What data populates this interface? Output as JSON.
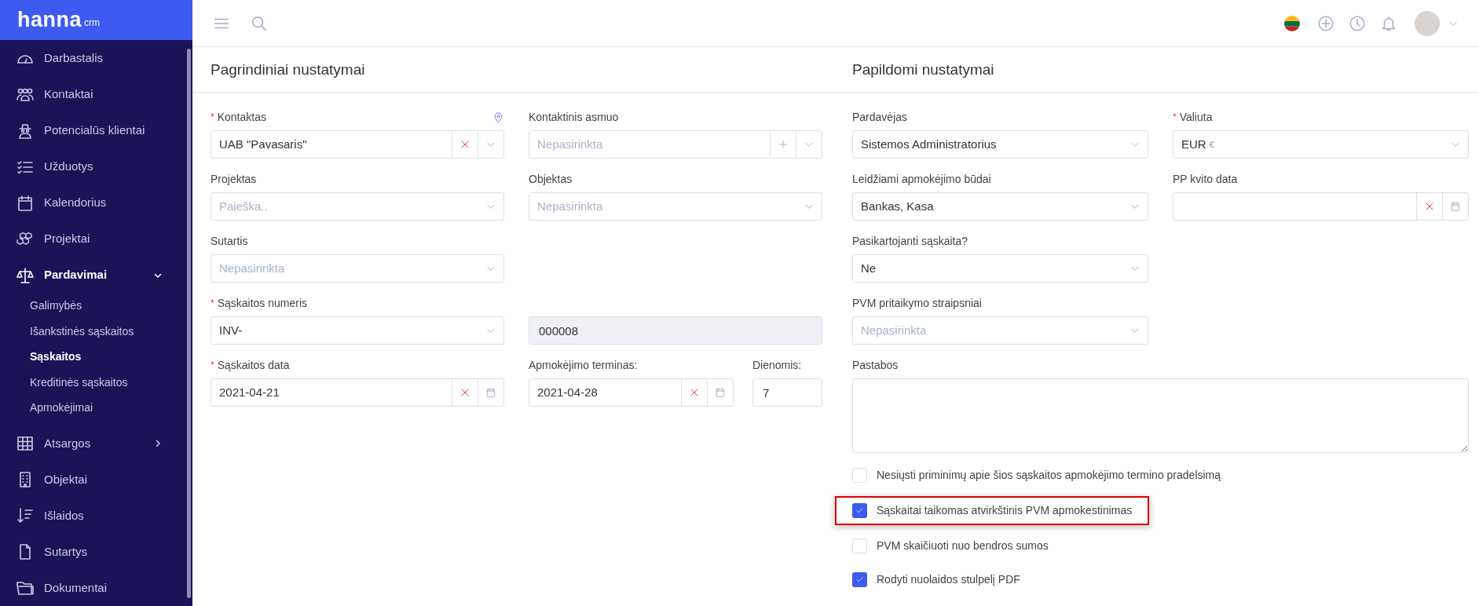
{
  "logo": {
    "name": "hanna",
    "suffix": "crm"
  },
  "sidebar": {
    "items": [
      {
        "label": "Darbastalis",
        "selected": false
      },
      {
        "label": "Kontaktai",
        "selected": false
      },
      {
        "label": "Potencialūs klientai",
        "selected": false
      },
      {
        "label": "Užduotys",
        "selected": false
      },
      {
        "label": "Kalendorius",
        "selected": false
      },
      {
        "label": "Projektai",
        "selected": false
      },
      {
        "label": "Pardavimai",
        "selected": true,
        "expanded": true,
        "children": [
          {
            "label": "Galimybės",
            "selected": false
          },
          {
            "label": "Išankstinės sąskaitos",
            "selected": false
          },
          {
            "label": "Sąskaitos",
            "selected": true
          },
          {
            "label": "Kreditinės sąskaitos",
            "selected": false
          },
          {
            "label": "Apmokėjimai",
            "selected": false
          }
        ]
      },
      {
        "label": "Atsargos",
        "selected": false,
        "expanded": false
      },
      {
        "label": "Objektai",
        "selected": false
      },
      {
        "label": "Išlaidos",
        "selected": false
      },
      {
        "label": "Sutartys",
        "selected": false
      },
      {
        "label": "Dokumentai",
        "selected": false
      }
    ]
  },
  "main_settings": {
    "title": "Pagrindiniai nustatymai",
    "rows": [
      {
        "fields": [
          {
            "kind": "select",
            "mark": "*",
            "label": "Kontaktas",
            "pin": true,
            "value": "UAB \"Pavasaris\"",
            "clearable": true
          },
          {
            "kind": "select",
            "label": "Kontaktinis asmuo",
            "placeholder": "Nepasirinkta",
            "addable": true
          }
        ]
      },
      {
        "fields": [
          {
            "kind": "select",
            "label": "Projektas",
            "placeholder": "Paieška.."
          },
          {
            "kind": "select",
            "label": "Objektas",
            "placeholder": "Nepasirinkta"
          }
        ]
      },
      {
        "fields": [
          {
            "kind": "select",
            "label": "Sutartis",
            "placeholder": "Nepasirinkta"
          }
        ]
      },
      {
        "fields": [
          {
            "kind": "select",
            "mark": "*",
            "label": "Sąskaitos numeris",
            "value": "INV-"
          },
          {
            "kind": "text",
            "value": "000008",
            "disabled": true
          }
        ]
      },
      {
        "fields": [
          {
            "kind": "date",
            "mark": "*",
            "label": "Sąskaitos data",
            "value": "2021-04-21"
          },
          {
            "kind": "group",
            "fields": [
              {
                "kind": "date",
                "label": "Apmokėjimo terminas:",
                "value": "2021-04-28"
              },
              {
                "kind": "text",
                "label": "Dienomis:",
                "value": "7",
                "disabled": false
              }
            ]
          }
        ]
      }
    ]
  },
  "extra_settings": {
    "title": "Papildomi nustatymai",
    "rows": [
      {
        "fields": [
          {
            "kind": "select",
            "label": "Pardavėjas",
            "value": "Sistemos Administratorius"
          },
          {
            "kind": "select",
            "mark": "*",
            "label": "Valiuta",
            "value": "EUR",
            "suffix": "€"
          }
        ]
      },
      {
        "fields": [
          {
            "kind": "select",
            "label": "Leidžiami apmokėjimo būdai",
            "value": "Bankas, Kasa"
          },
          {
            "kind": "date",
            "label": "PP kvito data"
          }
        ]
      },
      {
        "fields": [
          {
            "kind": "select",
            "label": "Pasikartojanti sąskaita?",
            "value": "Ne"
          }
        ]
      },
      {
        "fields": [
          {
            "kind": "select",
            "label": "PVM pritaikymo straipsniai",
            "placeholder": "Nepasirinkta"
          }
        ]
      },
      {
        "fields": [
          {
            "kind": "textarea",
            "label": "Pastabos"
          }
        ]
      }
    ],
    "checkboxes": [
      {
        "label": "Nesiųsti priminimų apie šios sąskaitos apmokėjimo termino pradelsimą",
        "checked": false,
        "highlighted": false
      },
      {
        "label": "Sąskaitai taikomas atvirkštinis PVM apmokestinimas",
        "checked": true,
        "highlighted": true
      },
      {
        "label": "PVM skaičiuoti nuo bendros sumos",
        "checked": false,
        "highlighted": false
      },
      {
        "label": "Rodyti nuolaidos stulpelį PDF",
        "checked": true,
        "highlighted": false
      }
    ]
  }
}
